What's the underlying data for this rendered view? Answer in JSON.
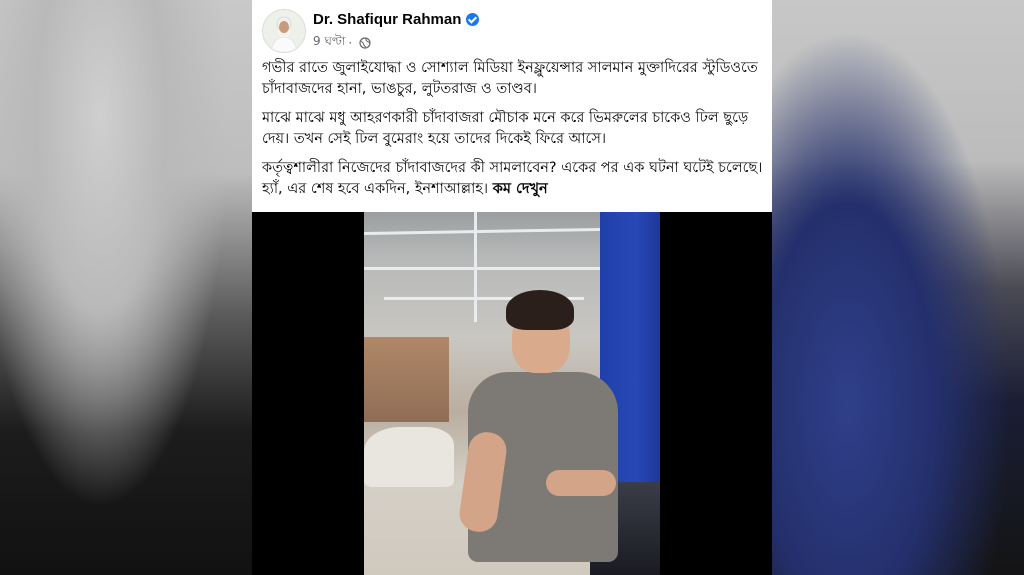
{
  "post": {
    "author_name": "Dr. Shafiqur Rahman",
    "time": "9 ঘণ্টা",
    "paragraphs": [
      "গভীর রাতে জুলাইযোদ্ধা ও সোশ্যাল মিডিয়া ইনফ্লুয়েন্সার সালমান মুক্তাদিরের স্টুডিওতে চাঁদাবাজদের হানা, ভাঙচুর, লুটতরাজ ও তাণ্ডব।",
      "মাঝে মাঝে মধু আহরণকারী চাঁদাবাজরা মৌচাক মনে করে ভিমরুলের চাকেও ঢিল ছুড়ে দেয়। তখন সেই ঢিল বুমেরাং হয়ে তাদের দিকেই ফিরে আসে।",
      "কর্তৃত্বশালীরা নিজেদের চাঁদাবাজদের কী সামলাবেন? একের পর এক ঘটনা ঘটেই চলেছে। হ্যাঁ, এর শেষ হবে একদিন, ইনশাআল্লাহ।"
    ],
    "see_less": "কম দেখুন"
  },
  "icons": {
    "verified": "verified-badge-icon",
    "audience": "globe-icon"
  },
  "colors": {
    "verified_blue": "#1877f2",
    "meta_gray": "#65676b"
  }
}
